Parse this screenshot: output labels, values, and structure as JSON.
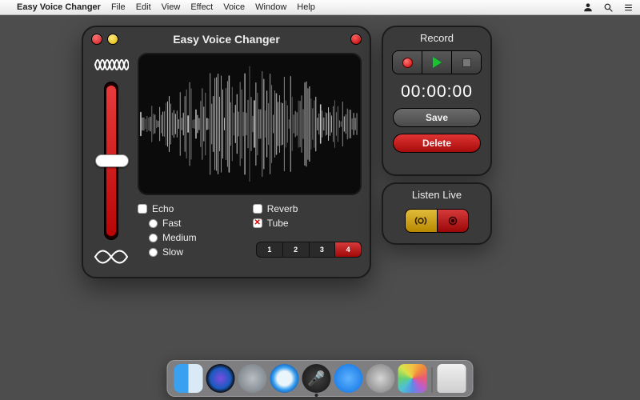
{
  "menubar": {
    "app_name": "Easy Voice Changer",
    "items": [
      "File",
      "Edit",
      "View",
      "Effect",
      "Voice",
      "Window",
      "Help"
    ]
  },
  "app": {
    "title": "Easy Voice Changer",
    "effects": {
      "echo": {
        "label": "Echo",
        "checked": false
      },
      "reverb": {
        "label": "Reverb",
        "checked": false
      },
      "tube": {
        "label": "Tube",
        "checked": true
      },
      "speed": {
        "fast": "Fast",
        "medium": "Medium",
        "slow": "Slow",
        "selected": null
      }
    },
    "presets": {
      "labels": [
        "1",
        "2",
        "3",
        "4"
      ],
      "active_index": 3
    }
  },
  "record": {
    "header": "Record",
    "timer": "00:00:00",
    "save_label": "Save",
    "delete_label": "Delete"
  },
  "listen": {
    "header": "Listen Live"
  },
  "dock": {
    "items": [
      "finder",
      "siri",
      "launchpad",
      "safari",
      "voice-changer",
      "appstore",
      "settings",
      "photos"
    ],
    "active": "voice-changer"
  }
}
